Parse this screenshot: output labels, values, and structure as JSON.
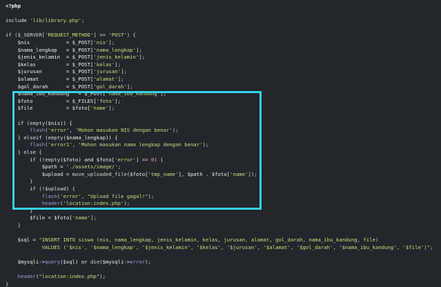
{
  "code": {
    "accent_color": "#33d4ec",
    "lines": [
      [
        {
          "t": "<?php",
          "c": "c-tag"
        }
      ],
      [
        {
          "t": "",
          "c": "c-pl"
        }
      ],
      [
        {
          "t": "include ",
          "c": "c-kw"
        },
        {
          "t": "'lib/library.php'",
          "c": "c-str"
        },
        {
          "t": ";",
          "c": "c-pl"
        }
      ],
      [
        {
          "t": "",
          "c": "c-pl"
        }
      ],
      [
        {
          "t": "if ($_SERVER[",
          "c": "c-pl"
        },
        {
          "t": "'REQUEST_METHOD'",
          "c": "c-str"
        },
        {
          "t": "] == ",
          "c": "c-pl"
        },
        {
          "t": "'POST'",
          "c": "c-str"
        },
        {
          "t": ") {",
          "c": "c-pl"
        }
      ],
      [
        {
          "t": "    $nis            = $_POST[",
          "c": "c-var"
        },
        {
          "t": "'nis'",
          "c": "c-str"
        },
        {
          "t": "];",
          "c": "c-pl"
        }
      ],
      [
        {
          "t": "    $nama_lengkap   = $_POST[",
          "c": "c-var"
        },
        {
          "t": "'nama_lengkap'",
          "c": "c-str"
        },
        {
          "t": "];",
          "c": "c-pl"
        }
      ],
      [
        {
          "t": "    $jenis_kelamin  = $_POST[",
          "c": "c-var"
        },
        {
          "t": "'jenis_kelamin'",
          "c": "c-str"
        },
        {
          "t": "];",
          "c": "c-pl"
        }
      ],
      [
        {
          "t": "    $kelas          = $_POST[",
          "c": "c-var"
        },
        {
          "t": "'kelas'",
          "c": "c-str"
        },
        {
          "t": "];",
          "c": "c-pl"
        }
      ],
      [
        {
          "t": "    $jurusan        = $_POST[",
          "c": "c-var"
        },
        {
          "t": "'jurusan'",
          "c": "c-str"
        },
        {
          "t": "];",
          "c": "c-pl"
        }
      ],
      [
        {
          "t": "    $alamat         = $_POST[",
          "c": "c-var"
        },
        {
          "t": "'alamat'",
          "c": "c-str"
        },
        {
          "t": "];",
          "c": "c-pl"
        }
      ],
      [
        {
          "t": "    $gol_darah      = $_POST[",
          "c": "c-var"
        },
        {
          "t": "'gol_darah'",
          "c": "c-str"
        },
        {
          "t": "];",
          "c": "c-pl"
        }
      ],
      [
        {
          "t": "    $nama_ibu_kandung   = $_POST[",
          "c": "c-var"
        },
        {
          "t": "'nama_ibu_kandung'",
          "c": "c-str"
        },
        {
          "t": "];",
          "c": "c-pl"
        }
      ],
      [
        {
          "t": "    $foto           = $_FILES[",
          "c": "c-var"
        },
        {
          "t": "'foto'",
          "c": "c-str"
        },
        {
          "t": "];",
          "c": "c-pl"
        }
      ],
      [
        {
          "t": "    $file           = $foto[",
          "c": "c-var"
        },
        {
          "t": "'name'",
          "c": "c-str"
        },
        {
          "t": "];",
          "c": "c-pl"
        }
      ],
      [
        {
          "t": "",
          "c": "c-pl"
        }
      ],
      [
        {
          "t": "    if (",
          "c": "c-kw"
        },
        {
          "t": "empty",
          "c": "c-pl"
        },
        {
          "t": "($nis)) {",
          "c": "c-var"
        }
      ],
      [
        {
          "t": "        ",
          "c": "c-pl"
        },
        {
          "t": "flash",
          "c": "c-fn"
        },
        {
          "t": "(",
          "c": "c-pl"
        },
        {
          "t": "'error'",
          "c": "c-str"
        },
        {
          "t": ", ",
          "c": "c-pl"
        },
        {
          "t": "'Mohon masukan NIS dengan benar'",
          "c": "c-str"
        },
        {
          "t": ");",
          "c": "c-pl"
        }
      ],
      [
        {
          "t": "    } elseif (",
          "c": "c-kw"
        },
        {
          "t": "empty",
          "c": "c-pl"
        },
        {
          "t": "($nama_lengkap)) {",
          "c": "c-var"
        }
      ],
      [
        {
          "t": "        ",
          "c": "c-pl"
        },
        {
          "t": "flash",
          "c": "c-fn"
        },
        {
          "t": "(",
          "c": "c-pl"
        },
        {
          "t": "'error1'",
          "c": "c-str"
        },
        {
          "t": ", ",
          "c": "c-pl"
        },
        {
          "t": "'Mohon masukan nama lengkap dengan benar'",
          "c": "c-str"
        },
        {
          "t": ");",
          "c": "c-pl"
        }
      ],
      [
        {
          "t": "    } else {",
          "c": "c-kw"
        }
      ],
      [
        {
          "t": "        if (!",
          "c": "c-kw"
        },
        {
          "t": "empty",
          "c": "c-pl"
        },
        {
          "t": "($foto) and $foto[",
          "c": "c-var"
        },
        {
          "t": "'error'",
          "c": "c-str"
        },
        {
          "t": "] == ",
          "c": "c-pl"
        },
        {
          "t": "0",
          "c": "c-num"
        },
        {
          "t": ") {",
          "c": "c-pl"
        }
      ],
      [
        {
          "t": "            $path = ",
          "c": "c-var"
        },
        {
          "t": "'./assets/image/'",
          "c": "c-str"
        },
        {
          "t": ";",
          "c": "c-pl"
        }
      ],
      [
        {
          "t": "            $upload = ",
          "c": "c-var"
        },
        {
          "t": "move_uploaded_file",
          "c": "c-pl"
        },
        {
          "t": "($foto[",
          "c": "c-var"
        },
        {
          "t": "'tmp_name'",
          "c": "c-str"
        },
        {
          "t": "], $path . $foto[",
          "c": "c-var"
        },
        {
          "t": "'name'",
          "c": "c-str"
        },
        {
          "t": "]);",
          "c": "c-pl"
        }
      ],
      [
        {
          "t": "        }",
          "c": "c-pl"
        }
      ],
      [
        {
          "t": "        if (!$upload) {",
          "c": "c-kw"
        }
      ],
      [
        {
          "t": "            ",
          "c": "c-pl"
        },
        {
          "t": "flash",
          "c": "c-fn"
        },
        {
          "t": "(",
          "c": "c-pl"
        },
        {
          "t": "'error'",
          "c": "c-str"
        },
        {
          "t": ", ",
          "c": "c-pl"
        },
        {
          "t": "\"Upload file gagal!\"",
          "c": "c-str"
        },
        {
          "t": ");",
          "c": "c-pl"
        }
      ],
      [
        {
          "t": "            ",
          "c": "c-pl"
        },
        {
          "t": "header",
          "c": "c-fn"
        },
        {
          "t": "(",
          "c": "c-pl"
        },
        {
          "t": "'location:index.php'",
          "c": "c-str"
        },
        {
          "t": ");",
          "c": "c-pl"
        }
      ],
      [
        {
          "t": "        }",
          "c": "c-pl"
        }
      ],
      [
        {
          "t": "        $file = $foto[",
          "c": "c-var"
        },
        {
          "t": "'name'",
          "c": "c-str"
        },
        {
          "t": "];",
          "c": "c-pl"
        }
      ],
      [
        {
          "t": "    }",
          "c": "c-pl"
        }
      ],
      [
        {
          "t": "",
          "c": "c-pl"
        }
      ],
      [
        {
          "t": "    $sql = ",
          "c": "c-var"
        },
        {
          "t": "\"INSERT INTO siswa (nis, nama_lengkap, jenis_kelamin, kelas, jurusan, alamat, gol_darah, nama_ibu_kandung, file)",
          "c": "c-str"
        }
      ],
      [
        {
          "t": "            VALUES ('$nis', '$nama_lengkap', '$jenis_kelamin', '$kelas', '$jurusan', '$alamat', '$gol_darah', '$nama_ibu_kandung', '$file')\"",
          "c": "c-str"
        },
        {
          "t": ";",
          "c": "c-pl"
        }
      ],
      [
        {
          "t": "",
          "c": "c-pl"
        }
      ],
      [
        {
          "t": "    $mysqli->",
          "c": "c-var"
        },
        {
          "t": "query",
          "c": "c-fn"
        },
        {
          "t": "($sql) or ",
          "c": "c-var"
        },
        {
          "t": "die",
          "c": "c-pl"
        },
        {
          "t": "($mysqli->",
          "c": "c-var"
        },
        {
          "t": "error",
          "c": "c-fn"
        },
        {
          "t": ");",
          "c": "c-pl"
        }
      ],
      [
        {
          "t": "",
          "c": "c-pl"
        }
      ],
      [
        {
          "t": "    ",
          "c": "c-pl"
        },
        {
          "t": "header",
          "c": "c-fn"
        },
        {
          "t": "(",
          "c": "c-pl"
        },
        {
          "t": "\"location:index.php\"",
          "c": "c-str"
        },
        {
          "t": ");",
          "c": "c-pl"
        }
      ],
      [
        {
          "t": "}",
          "c": "c-pl"
        }
      ]
    ]
  }
}
